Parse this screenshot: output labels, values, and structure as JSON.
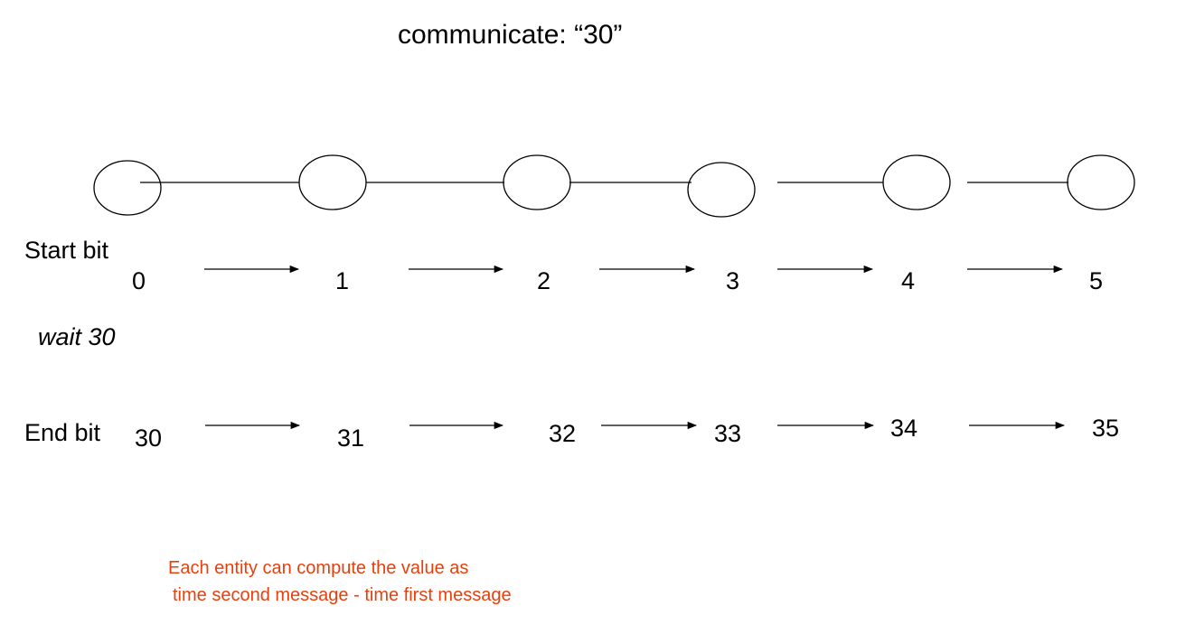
{
  "title": "communicate: “30”",
  "rows": {
    "start_label": "Start bit",
    "end_label": "End bit",
    "wait_label": "wait 30"
  },
  "start_values": [
    "0",
    "1",
    "2",
    "3",
    "4",
    "5"
  ],
  "end_values": [
    "30",
    "31",
    "32",
    "33",
    "34",
    "35"
  ],
  "note": {
    "line1": "Each entity can compute the value as",
    "line2": "time second message - time first message"
  },
  "colors": {
    "note": "#e8400c"
  }
}
